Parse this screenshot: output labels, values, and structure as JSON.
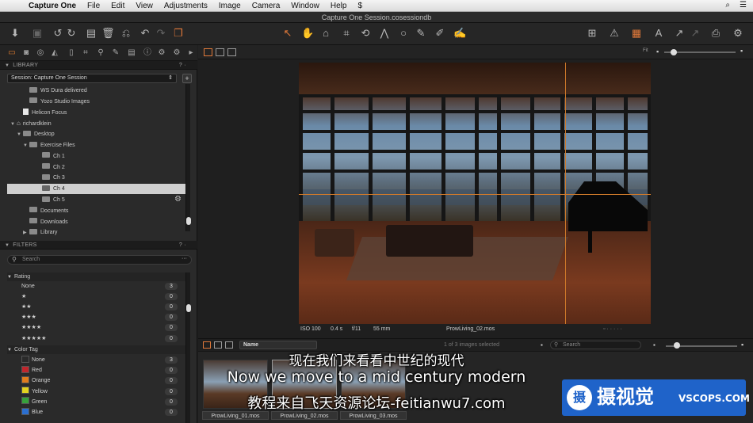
{
  "menubar": {
    "items": [
      "Capture One",
      "File",
      "Edit",
      "View",
      "Adjustments",
      "Image",
      "Camera",
      "Window",
      "Help"
    ]
  },
  "window": {
    "title": "Capture One Session.cosessiondb"
  },
  "library": {
    "section_title": "LIBRARY",
    "session_label": "Session: Capture One Session",
    "items": [
      {
        "label": "WS Dura delivered",
        "kind": "folder",
        "indent": 2
      },
      {
        "label": "Yozo Studio Images",
        "kind": "folder",
        "indent": 2
      },
      {
        "label": "Helicon Focus",
        "kind": "file",
        "indent": 1
      },
      {
        "label": "richardklein",
        "kind": "home",
        "indent": 0
      },
      {
        "label": "Desktop",
        "kind": "folder",
        "indent": 1
      },
      {
        "label": "Exercise Files",
        "kind": "folder",
        "indent": 2
      },
      {
        "label": "Ch 1",
        "kind": "folder",
        "indent": 4
      },
      {
        "label": "Ch 2",
        "kind": "folder",
        "indent": 4
      },
      {
        "label": "Ch 3",
        "kind": "folder",
        "indent": 4
      },
      {
        "label": "Ch 4",
        "kind": "folder",
        "indent": 4,
        "selected": true
      },
      {
        "label": "Ch 5",
        "kind": "folder",
        "indent": 4
      },
      {
        "label": "Documents",
        "kind": "folder",
        "indent": 2
      },
      {
        "label": "Downloads",
        "kind": "folder",
        "indent": 2
      },
      {
        "label": "Library",
        "kind": "folder",
        "indent": 2
      }
    ]
  },
  "filters": {
    "section_title": "FILTERS",
    "search_placeholder": "Search",
    "rating_title": "Rating",
    "rating_rows": [
      {
        "label": "None",
        "count": "3"
      },
      {
        "label": "★",
        "count": "0"
      },
      {
        "label": "★★",
        "count": "0"
      },
      {
        "label": "★★★",
        "count": "0"
      },
      {
        "label": "★★★★",
        "count": "0"
      },
      {
        "label": "★★★★★",
        "count": "0"
      }
    ],
    "color_title": "Color Tag",
    "color_rows": [
      {
        "label": "None",
        "count": "3",
        "color": "#2a2a2a"
      },
      {
        "label": "Red",
        "count": "0",
        "color": "#c0262c"
      },
      {
        "label": "Orange",
        "count": "0",
        "color": "#e07c1e"
      },
      {
        "label": "Yellow",
        "count": "0",
        "color": "#e4d220"
      },
      {
        "label": "Green",
        "count": "0",
        "color": "#37a13b"
      },
      {
        "label": "Blue",
        "count": "0",
        "color": "#2b6fd0"
      }
    ]
  },
  "viewer": {
    "zoom_label": "Fit",
    "info": {
      "iso": "ISO 100",
      "shutter": "0.4 s",
      "aperture": "f/11",
      "focal": "55 mm",
      "filename": "ProwLiving_02.mos"
    }
  },
  "browser": {
    "sort_label": "Name",
    "count_label": "1 of 3 images selected",
    "search_placeholder": "Search",
    "thumbnails": [
      {
        "label": "ProwLiving_01.mos"
      },
      {
        "label": "ProwLiving_02.mos",
        "selected": true
      },
      {
        "label": "ProwLiving_03.mos"
      }
    ]
  },
  "subtitles": {
    "cn_line1": "现在我们来看看中世纪的现代",
    "en_line": "Now we move to a mid century modern",
    "cn_line2": "教程来自飞天资源论坛-feitianwu7.com"
  },
  "watermark": {
    "logo_char": "摄",
    "cn": "摄视觉",
    "en": "VSCOPS.COM"
  },
  "colors": {
    "accent": "#e0793a",
    "selection": "#cfcfcf"
  }
}
